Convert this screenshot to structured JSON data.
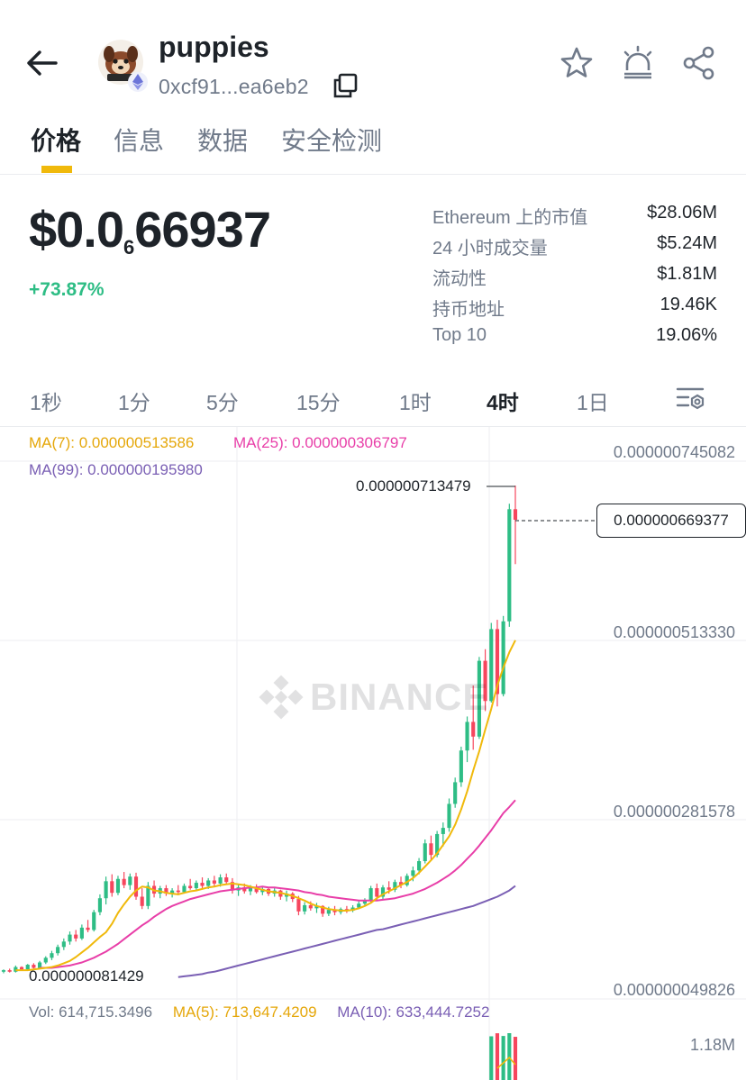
{
  "header": {
    "token_name": "puppies",
    "address": "0xcf91...ea6eb2"
  },
  "tabs": [
    {
      "label": "价格",
      "active": true
    },
    {
      "label": "信息",
      "active": false
    },
    {
      "label": "数据",
      "active": false
    },
    {
      "label": "安全检测",
      "active": false
    }
  ],
  "price": {
    "prefix": "$0.0",
    "zeros_count": "6",
    "digits": "66937",
    "change": "+73.87%"
  },
  "stats": [
    {
      "label": "Ethereum 上的市值",
      "value": "$28.06M"
    },
    {
      "label": "24 小时成交量",
      "value": "$5.24M"
    },
    {
      "label": "流动性",
      "value": "$1.81M"
    },
    {
      "label": "持币地址",
      "value": "19.46K"
    },
    {
      "label": "Top 10",
      "value": "19.06%"
    }
  ],
  "intervals": [
    {
      "label": "1秒",
      "active": false
    },
    {
      "label": "1分",
      "active": false
    },
    {
      "label": "5分",
      "active": false
    },
    {
      "label": "15分",
      "active": false
    },
    {
      "label": "1时",
      "active": false
    },
    {
      "label": "4时",
      "active": true
    },
    {
      "label": "1日",
      "active": false
    }
  ],
  "chart": {
    "ma7": "MA(7): 0.000000513586",
    "ma25": "MA(25): 0.000000306797",
    "ma99": "MA(99): 0.000000195980",
    "y_ticks": [
      "0.000000745082",
      "0.000000513330",
      "0.000000281578",
      "0.000000049826"
    ],
    "current_price": "0.000000669377",
    "high_label": "0.000000713479",
    "low_label": "0.000000081429",
    "watermark": "BINANCE",
    "vol": "Vol: 614,715.3496",
    "vol_ma5": "MA(5): 713,647.4209",
    "vol_ma10": "MA(10): 633,444.7252",
    "vol_axis": "1.18M"
  },
  "colors": {
    "up": "#2ebd85",
    "down": "#f6465d",
    "ma7": "#f0b90b",
    "ma25": "#e83ea8",
    "ma99": "#7a5fb4",
    "accent": "#f0b90b"
  },
  "chart_data": {
    "type": "candlestick",
    "interval": "4h",
    "ylim": [
      4.9826e-08,
      7.45082e-07
    ],
    "high": 7.13479e-07,
    "low": 8.1429e-08,
    "last": 6.69377e-07,
    "candles": [
      [
        8.5e-08,
        8.8e-08,
        8.3e-08,
        8.7e-08
      ],
      [
        8.7e-08,
        8.9e-08,
        8.4e-08,
        8.5e-08
      ],
      [
        8.5e-08,
        9.3e-08,
        8.4e-08,
        9.1e-08
      ],
      [
        9.1e-08,
        9.2e-08,
        8.6e-08,
        8.8e-08
      ],
      [
        8.8e-08,
        9.5e-08,
        8.7e-08,
        9.4e-08
      ],
      [
        9.4e-08,
        9.6e-08,
        8.9e-08,
        9e-08
      ],
      [
        9e-08,
        9.9e-08,
        8.9e-08,
        9.7e-08
      ],
      [
        9.7e-08,
        1.05e-07,
        9.5e-08,
        1.03e-07
      ],
      [
        1.03e-07,
        1.12e-07,
        1e-07,
        1.09e-07
      ],
      [
        1.09e-07,
        1.2e-07,
        1.06e-07,
        1.17e-07
      ],
      [
        1.17e-07,
        1.28e-07,
        1.13e-07,
        1.24e-07
      ],
      [
        1.24e-07,
        1.37e-07,
        1.2e-07,
        1.33e-07
      ],
      [
        1.33e-07,
        1.39e-07,
        1.24e-07,
        1.28e-07
      ],
      [
        1.28e-07,
        1.46e-07,
        1.26e-07,
        1.42e-07
      ],
      [
        1.42e-07,
        1.52e-07,
        1.36e-07,
        1.39e-07
      ],
      [
        1.39e-07,
        1.65e-07,
        1.37e-07,
        1.62e-07
      ],
      [
        1.62e-07,
        1.85e-07,
        1.58e-07,
        1.8e-07
      ],
      [
        1.8e-07,
        2.08e-07,
        1.72e-07,
        2.02e-07
      ],
      [
        2.02e-07,
        2.11e-07,
        1.82e-07,
        1.87e-07
      ],
      [
        1.87e-07,
        2.09e-07,
        1.84e-07,
        2.05e-07
      ],
      [
        2.05e-07,
        2.14e-07,
        1.93e-07,
        1.97e-07
      ],
      [
        1.97e-07,
        2.12e-07,
        1.91e-07,
        2.08e-07
      ],
      [
        2.08e-07,
        2.13e-07,
        1.78e-07,
        1.82e-07
      ],
      [
        1.82e-07,
        1.93e-07,
        1.66e-07,
        1.7e-07
      ],
      [
        1.7e-07,
        2.01e-07,
        1.66e-07,
        1.96e-07
      ],
      [
        1.96e-07,
        2.03e-07,
        1.81e-07,
        1.86e-07
      ],
      [
        1.86e-07,
        1.96e-07,
        1.8e-07,
        1.93e-07
      ],
      [
        1.93e-07,
        1.97e-07,
        1.83e-07,
        1.86e-07
      ],
      [
        1.86e-07,
        1.93e-07,
        1.81e-07,
        1.9e-07
      ],
      [
        1.9e-07,
        1.97e-07,
        1.84e-07,
        1.88e-07
      ],
      [
        1.88e-07,
        1.99e-07,
        1.86e-07,
        1.96e-07
      ],
      [
        1.96e-07,
        2.05e-07,
        1.91e-07,
        1.93e-07
      ],
      [
        1.93e-07,
        2.03e-07,
        1.89e-07,
        2e-07
      ],
      [
        2e-07,
        2.07e-07,
        1.93e-07,
        1.96e-07
      ],
      [
        1.96e-07,
        2.06e-07,
        1.92e-07,
        2.03e-07
      ],
      [
        2.03e-07,
        2.09e-07,
        1.96e-07,
        1.99e-07
      ],
      [
        1.99e-07,
        2.11e-07,
        1.95e-07,
        2.07e-07
      ],
      [
        2.07e-07,
        2.12e-07,
        1.98e-07,
        2.01e-07
      ],
      [
        2.01e-07,
        2.06e-07,
        1.86e-07,
        1.9e-07
      ],
      [
        1.9e-07,
        1.98e-07,
        1.83e-07,
        1.94e-07
      ],
      [
        1.94e-07,
        1.99e-07,
        1.86e-07,
        1.89e-07
      ],
      [
        1.89e-07,
        1.97e-07,
        1.84e-07,
        1.93e-07
      ],
      [
        1.93e-07,
        1.98e-07,
        1.86e-07,
        1.88e-07
      ],
      [
        1.88e-07,
        1.96e-07,
        1.84e-07,
        1.92e-07
      ],
      [
        1.92e-07,
        1.94e-07,
        1.83e-07,
        1.86e-07
      ],
      [
        1.86e-07,
        1.93e-07,
        1.82e-07,
        1.9e-07
      ],
      [
        1.9e-07,
        1.91e-07,
        1.78e-07,
        1.82e-07
      ],
      [
        1.82e-07,
        1.9e-07,
        1.76e-07,
        1.86e-07
      ],
      [
        1.86e-07,
        1.88e-07,
        1.75e-07,
        1.79e-07
      ],
      [
        1.79e-07,
        1.83e-07,
        1.58e-07,
        1.63e-07
      ],
      [
        1.63e-07,
        1.75e-07,
        1.59e-07,
        1.71e-07
      ],
      [
        1.71e-07,
        1.76e-07,
        1.64e-07,
        1.67e-07
      ],
      [
        1.67e-07,
        1.74e-07,
        1.61e-07,
        1.7e-07
      ],
      [
        1.7e-07,
        1.71e-07,
        1.56e-07,
        1.6e-07
      ],
      [
        1.6e-07,
        1.69e-07,
        1.57e-07,
        1.65e-07
      ],
      [
        1.65e-07,
        1.7e-07,
        1.58e-07,
        1.62e-07
      ],
      [
        1.62e-07,
        1.68e-07,
        1.59e-07,
        1.66e-07
      ],
      [
        1.66e-07,
        1.7e-07,
        1.61e-07,
        1.64e-07
      ],
      [
        1.64e-07,
        1.71e-07,
        1.62e-07,
        1.68e-07
      ],
      [
        1.68e-07,
        1.76e-07,
        1.66e-07,
        1.73e-07
      ],
      [
        1.73e-07,
        1.8e-07,
        1.7e-07,
        1.77e-07
      ],
      [
        1.77e-07,
        1.96e-07,
        1.74e-07,
        1.93e-07
      ],
      [
        1.93e-07,
        1.99e-07,
        1.78e-07,
        1.82e-07
      ],
      [
        1.82e-07,
        1.97e-07,
        1.79e-07,
        1.94e-07
      ],
      [
        1.94e-07,
        2.02e-07,
        1.86e-07,
        1.91e-07
      ],
      [
        1.91e-07,
        2.04e-07,
        1.88e-07,
        2.01e-07
      ],
      [
        2.01e-07,
        2.08e-07,
        1.93e-07,
        1.97e-07
      ],
      [
        1.97e-07,
        2.12e-07,
        1.95e-07,
        2.09e-07
      ],
      [
        2.09e-07,
        2.21e-07,
        2.02e-07,
        2.16e-07
      ],
      [
        2.16e-07,
        2.32e-07,
        2.11e-07,
        2.28e-07
      ],
      [
        2.28e-07,
        2.56e-07,
        2.25e-07,
        2.51e-07
      ],
      [
        2.51e-07,
        2.61e-07,
        2.3e-07,
        2.36e-07
      ],
      [
        2.36e-07,
        2.67e-07,
        2.33e-07,
        2.63e-07
      ],
      [
        2.63e-07,
        2.78e-07,
        2.47e-07,
        2.71e-07
      ],
      [
        2.71e-07,
        3.09e-07,
        2.66e-07,
        3.02e-07
      ],
      [
        3.02e-07,
        3.36e-07,
        2.97e-07,
        3.3e-07
      ],
      [
        3.3e-07,
        3.76e-07,
        3.24e-07,
        3.71e-07
      ],
      [
        3.71e-07,
        4.15e-07,
        3.56e-07,
        4.08e-07
      ],
      [
        4.08e-07,
        4.55e-07,
        3.72e-07,
        3.89e-07
      ],
      [
        3.89e-07,
        4.92e-07,
        3.86e-07,
        4.87e-07
      ],
      [
        4.87e-07,
        5.02e-07,
        4.22e-07,
        4.35e-07
      ],
      [
        4.35e-07,
        5.36e-07,
        4.33e-07,
        5.28e-07
      ],
      [
        5.28e-07,
        5.4e-07,
        4.28e-07,
        4.44e-07
      ],
      [
        4.44e-07,
        5.45e-07,
        4.41e-07,
        5.38e-07
      ],
      [
        5.38e-07,
        6.9e-07,
        5.31e-07,
        6.83e-07
      ],
      [
        6.83e-07,
        7.13479e-07,
        6.12e-07,
        6.69377e-07
      ]
    ],
    "ma7": [
      8.7e-08,
      8.7e-08,
      8.7e-08,
      8.8e-08,
      8.9e-08,
      9e-08,
      9.1e-08,
      9.3e-08,
      9.6e-08,
      9.9e-08,
      1.04e-07,
      1.1e-07,
      1.16e-07,
      1.23e-07,
      1.3e-07,
      1.36e-07,
      1.47e-07,
      1.61e-07,
      1.72e-07,
      1.82e-07,
      1.9e-07,
      1.95e-07,
      1.94e-07,
      1.9e-07,
      1.89e-07,
      1.87e-07,
      1.86e-07,
      1.85e-07,
      1.87e-07,
      1.89e-07,
      1.9e-07,
      1.92e-07,
      1.94e-07,
      1.95e-07,
      1.97e-07,
      1.98e-07,
      1.99e-07,
      1.98e-07,
      1.97e-07,
      1.95e-07,
      1.93e-07,
      1.91e-07,
      1.89e-07,
      1.88e-07,
      1.87e-07,
      1.85e-07,
      1.83e-07,
      1.8e-07,
      1.77e-07,
      1.73e-07,
      1.7e-07,
      1.68e-07,
      1.66e-07,
      1.65e-07,
      1.64e-07,
      1.64e-07,
      1.65e-07,
      1.67e-07,
      1.7e-07,
      1.74e-07,
      1.8e-07,
      1.85e-07,
      1.89e-07,
      1.93e-07,
      1.97e-07,
      2.01e-07,
      2.06e-07,
      2.13e-07,
      2.21e-07,
      2.29e-07,
      2.38e-07,
      2.49e-07,
      2.6e-07,
      2.75e-07,
      2.95e-07,
      3.18e-07,
      3.45e-07,
      3.7e-07,
      3.98e-07,
      4.25e-07,
      4.55e-07,
      4.78e-07,
      4.98e-07,
      5.13586e-07
    ],
    "ma25": [
      9e-08,
      9e-08,
      9e-08,
      9.1e-08,
      9.2e-08,
      9.3e-08,
      9.5e-08,
      9.7e-08,
      1e-07,
      1.03e-07,
      1.07e-07,
      1.11e-07,
      1.16e-07,
      1.21e-07,
      1.27e-07,
      1.33e-07,
      1.39e-07,
      1.45e-07,
      1.5e-07,
      1.56e-07,
      1.61e-07,
      1.66e-07,
      1.7e-07,
      1.73e-07,
      1.76e-07,
      1.79e-07,
      1.81e-07,
      1.83e-07,
      1.85e-07,
      1.87e-07,
      1.89e-07,
      1.9e-07,
      1.91e-07,
      1.92e-07,
      1.93e-07,
      1.94e-07,
      1.94e-07,
      1.95e-07,
      1.94e-07,
      1.94e-07,
      1.93e-07,
      1.92e-07,
      1.91e-07,
      1.9e-07,
      1.88e-07,
      1.87e-07,
      1.85e-07,
      1.84e-07,
      1.82e-07,
      1.81e-07,
      1.8e-07,
      1.79e-07,
      1.78e-07,
      1.77e-07,
      1.77e-07,
      1.77e-07,
      1.77e-07,
      1.78e-07,
      1.79e-07,
      1.8e-07,
      1.82e-07,
      1.84e-07,
      1.86e-07,
      1.89e-07,
      1.92e-07,
      1.96e-07,
      2e-07,
      2.05e-07,
      2.1e-07,
      2.16e-07,
      2.23e-07,
      2.31e-07,
      2.39e-07,
      2.48e-07,
      2.58e-07,
      2.68e-07,
      2.79e-07,
      2.9e-07,
      2.98e-07,
      3.06797e-07
    ],
    "ma99": [
      7.8e-08,
      7.9e-08,
      8e-08,
      8.1e-08,
      8.2e-08,
      8.4e-08,
      8.5e-08,
      8.7e-08,
      8.9e-08,
      9.1e-08,
      9.3e-08,
      9.5e-08,
      9.7e-08,
      9.9e-08,
      1.01e-07,
      1.03e-07,
      1.05e-07,
      1.07e-07,
      1.09e-07,
      1.11e-07,
      1.13e-07,
      1.15e-07,
      1.17e-07,
      1.19e-07,
      1.21e-07,
      1.23e-07,
      1.25e-07,
      1.27e-07,
      1.29e-07,
      1.31e-07,
      1.33e-07,
      1.35e-07,
      1.37e-07,
      1.39e-07,
      1.4e-07,
      1.42e-07,
      1.44e-07,
      1.46e-07,
      1.48e-07,
      1.5e-07,
      1.52e-07,
      1.54e-07,
      1.56e-07,
      1.58e-07,
      1.6e-07,
      1.62e-07,
      1.64e-07,
      1.66e-07,
      1.68e-07,
      1.7e-07,
      1.73e-07,
      1.76e-07,
      1.79e-07,
      1.82e-07,
      1.86e-07,
      1.9e-07,
      1.9598e-07
    ]
  }
}
